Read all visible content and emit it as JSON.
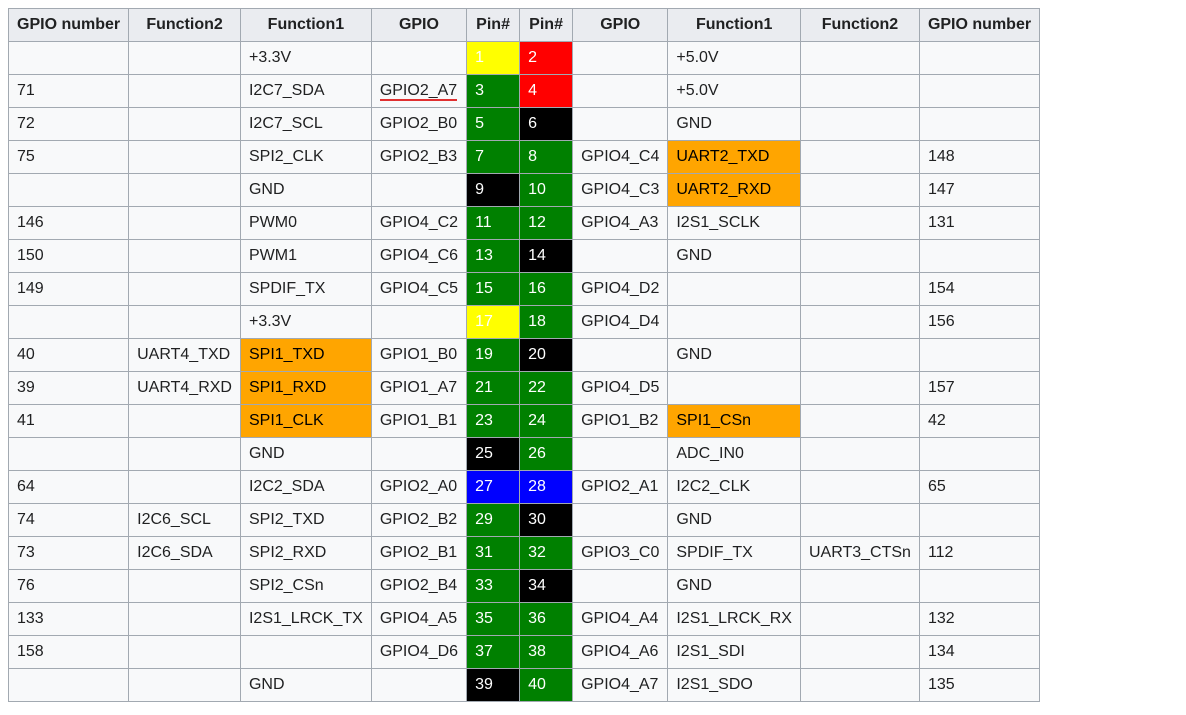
{
  "headers": [
    "GPIO number",
    "Function2",
    "Function1",
    "GPIO",
    "Pin#",
    "Pin#",
    "GPIO",
    "Function1",
    "Function2",
    "GPIO number"
  ],
  "pin_colors": {
    "yellow": "c-yellow",
    "red": "c-red",
    "green": "c-green",
    "black": "c-black",
    "blue": "c-blue"
  },
  "rows": [
    {
      "l_num": "",
      "l_f2": "",
      "l_f1": "+3.3V",
      "l_f1_hl": "",
      "l_gpio": "",
      "l_gpio_ul": false,
      "l_pin": "1",
      "l_pc": "yellow",
      "r_pin": "2",
      "r_pc": "red",
      "r_gpio": "",
      "r_f1": "+5.0V",
      "r_f1_hl": "",
      "r_f2": "",
      "r_num": ""
    },
    {
      "l_num": "71",
      "l_f2": "",
      "l_f1": "I2C7_SDA",
      "l_f1_hl": "",
      "l_gpio": "GPIO2_A7",
      "l_gpio_ul": true,
      "l_pin": "3",
      "l_pc": "green",
      "r_pin": "4",
      "r_pc": "red",
      "r_gpio": "",
      "r_f1": "+5.0V",
      "r_f1_hl": "",
      "r_f2": "",
      "r_num": ""
    },
    {
      "l_num": "72",
      "l_f2": "",
      "l_f1": "I2C7_SCL",
      "l_f1_hl": "",
      "l_gpio": "GPIO2_B0",
      "l_gpio_ul": false,
      "l_pin": "5",
      "l_pc": "green",
      "r_pin": "6",
      "r_pc": "black",
      "r_gpio": "",
      "r_f1": "GND",
      "r_f1_hl": "",
      "r_f2": "",
      "r_num": ""
    },
    {
      "l_num": "75",
      "l_f2": "",
      "l_f1": "SPI2_CLK",
      "l_f1_hl": "",
      "l_gpio": "GPIO2_B3",
      "l_gpio_ul": false,
      "l_pin": "7",
      "l_pc": "green",
      "r_pin": "8",
      "r_pc": "green",
      "r_gpio": "GPIO4_C4",
      "r_f1": "UART2_TXD",
      "r_f1_hl": "orange",
      "r_f2": "",
      "r_num": "148"
    },
    {
      "l_num": "",
      "l_f2": "",
      "l_f1": "GND",
      "l_f1_hl": "",
      "l_gpio": "",
      "l_gpio_ul": false,
      "l_pin": "9",
      "l_pc": "black",
      "r_pin": "10",
      "r_pc": "green",
      "r_gpio": "GPIO4_C3",
      "r_f1": "UART2_RXD",
      "r_f1_hl": "orange",
      "r_f2": "",
      "r_num": "147"
    },
    {
      "l_num": "146",
      "l_f2": "",
      "l_f1": "PWM0",
      "l_f1_hl": "",
      "l_gpio": "GPIO4_C2",
      "l_gpio_ul": false,
      "l_pin": "11",
      "l_pc": "green",
      "r_pin": "12",
      "r_pc": "green",
      "r_gpio": "GPIO4_A3",
      "r_f1": "I2S1_SCLK",
      "r_f1_hl": "",
      "r_f2": "",
      "r_num": "131"
    },
    {
      "l_num": "150",
      "l_f2": "",
      "l_f1": "PWM1",
      "l_f1_hl": "",
      "l_gpio": "GPIO4_C6",
      "l_gpio_ul": false,
      "l_pin": "13",
      "l_pc": "green",
      "r_pin": "14",
      "r_pc": "black",
      "r_gpio": "",
      "r_f1": "GND",
      "r_f1_hl": "",
      "r_f2": "",
      "r_num": ""
    },
    {
      "l_num": "149",
      "l_f2": "",
      "l_f1": "SPDIF_TX",
      "l_f1_hl": "",
      "l_gpio": "GPIO4_C5",
      "l_gpio_ul": false,
      "l_pin": "15",
      "l_pc": "green",
      "r_pin": "16",
      "r_pc": "green",
      "r_gpio": "GPIO4_D2",
      "r_f1": "",
      "r_f1_hl": "",
      "r_f2": "",
      "r_num": "154"
    },
    {
      "l_num": "",
      "l_f2": "",
      "l_f1": "+3.3V",
      "l_f1_hl": "",
      "l_gpio": "",
      "l_gpio_ul": false,
      "l_pin": "17",
      "l_pc": "yellow",
      "r_pin": "18",
      "r_pc": "green",
      "r_gpio": "GPIO4_D4",
      "r_f1": "",
      "r_f1_hl": "",
      "r_f2": "",
      "r_num": "156"
    },
    {
      "l_num": "40",
      "l_f2": "UART4_TXD",
      "l_f1": "SPI1_TXD",
      "l_f1_hl": "orange",
      "l_gpio": "GPIO1_B0",
      "l_gpio_ul": false,
      "l_pin": "19",
      "l_pc": "green",
      "r_pin": "20",
      "r_pc": "black",
      "r_gpio": "",
      "r_f1": "GND",
      "r_f1_hl": "",
      "r_f2": "",
      "r_num": ""
    },
    {
      "l_num": "39",
      "l_f2": "UART4_RXD",
      "l_f1": "SPI1_RXD",
      "l_f1_hl": "orange",
      "l_gpio": "GPIO1_A7",
      "l_gpio_ul": false,
      "l_pin": "21",
      "l_pc": "green",
      "r_pin": "22",
      "r_pc": "green",
      "r_gpio": "GPIO4_D5",
      "r_f1": "",
      "r_f1_hl": "",
      "r_f2": "",
      "r_num": "157"
    },
    {
      "l_num": "41",
      "l_f2": "",
      "l_f1": "SPI1_CLK",
      "l_f1_hl": "orange",
      "l_gpio": "GPIO1_B1",
      "l_gpio_ul": false,
      "l_pin": "23",
      "l_pc": "green",
      "r_pin": "24",
      "r_pc": "green",
      "r_gpio": "GPIO1_B2",
      "r_f1": "SPI1_CSn",
      "r_f1_hl": "orange",
      "r_f2": "",
      "r_num": "42"
    },
    {
      "l_num": "",
      "l_f2": "",
      "l_f1": "GND",
      "l_f1_hl": "",
      "l_gpio": "",
      "l_gpio_ul": false,
      "l_pin": "25",
      "l_pc": "black",
      "r_pin": "26",
      "r_pc": "green",
      "r_gpio": "",
      "r_f1": "ADC_IN0",
      "r_f1_hl": "",
      "r_f2": "",
      "r_num": ""
    },
    {
      "l_num": "64",
      "l_f2": "",
      "l_f1": "I2C2_SDA",
      "l_f1_hl": "",
      "l_gpio": "GPIO2_A0",
      "l_gpio_ul": false,
      "l_pin": "27",
      "l_pc": "blue",
      "r_pin": "28",
      "r_pc": "blue",
      "r_gpio": "GPIO2_A1",
      "r_f1": "I2C2_CLK",
      "r_f1_hl": "",
      "r_f2": "",
      "r_num": "65"
    },
    {
      "l_num": "74",
      "l_f2": "I2C6_SCL",
      "l_f1": "SPI2_TXD",
      "l_f1_hl": "",
      "l_gpio": "GPIO2_B2",
      "l_gpio_ul": false,
      "l_pin": "29",
      "l_pc": "green",
      "r_pin": "30",
      "r_pc": "black",
      "r_gpio": "",
      "r_f1": "GND",
      "r_f1_hl": "",
      "r_f2": "",
      "r_num": ""
    },
    {
      "l_num": "73",
      "l_f2": "I2C6_SDA",
      "l_f1": "SPI2_RXD",
      "l_f1_hl": "",
      "l_gpio": "GPIO2_B1",
      "l_gpio_ul": false,
      "l_pin": "31",
      "l_pc": "green",
      "r_pin": "32",
      "r_pc": "green",
      "r_gpio": "GPIO3_C0",
      "r_f1": "SPDIF_TX",
      "r_f1_hl": "",
      "r_f2": "UART3_CTSn",
      "r_num": "112"
    },
    {
      "l_num": "76",
      "l_f2": "",
      "l_f1": "SPI2_CSn",
      "l_f1_hl": "",
      "l_gpio": "GPIO2_B4",
      "l_gpio_ul": false,
      "l_pin": "33",
      "l_pc": "green",
      "r_pin": "34",
      "r_pc": "black",
      "r_gpio": "",
      "r_f1": "GND",
      "r_f1_hl": "",
      "r_f2": "",
      "r_num": ""
    },
    {
      "l_num": "133",
      "l_f2": "",
      "l_f1": "I2S1_LRCK_TX",
      "l_f1_hl": "",
      "l_gpio": "GPIO4_A5",
      "l_gpio_ul": false,
      "l_pin": "35",
      "l_pc": "green",
      "r_pin": "36",
      "r_pc": "green",
      "r_gpio": "GPIO4_A4",
      "r_f1": "I2S1_LRCK_RX",
      "r_f1_hl": "",
      "r_f2": "",
      "r_num": "132"
    },
    {
      "l_num": "158",
      "l_f2": "",
      "l_f1": "",
      "l_f1_hl": "",
      "l_gpio": "GPIO4_D6",
      "l_gpio_ul": false,
      "l_pin": "37",
      "l_pc": "green",
      "r_pin": "38",
      "r_pc": "green",
      "r_gpio": "GPIO4_A6",
      "r_f1": "I2S1_SDI",
      "r_f1_hl": "",
      "r_f2": "",
      "r_num": "134"
    },
    {
      "l_num": "",
      "l_f2": "",
      "l_f1": "GND",
      "l_f1_hl": "",
      "l_gpio": "",
      "l_gpio_ul": false,
      "l_pin": "39",
      "l_pc": "black",
      "r_pin": "40",
      "r_pc": "green",
      "r_gpio": "GPIO4_A7",
      "r_f1": "I2S1_SDO",
      "r_f1_hl": "",
      "r_f2": "",
      "r_num": "135"
    }
  ]
}
